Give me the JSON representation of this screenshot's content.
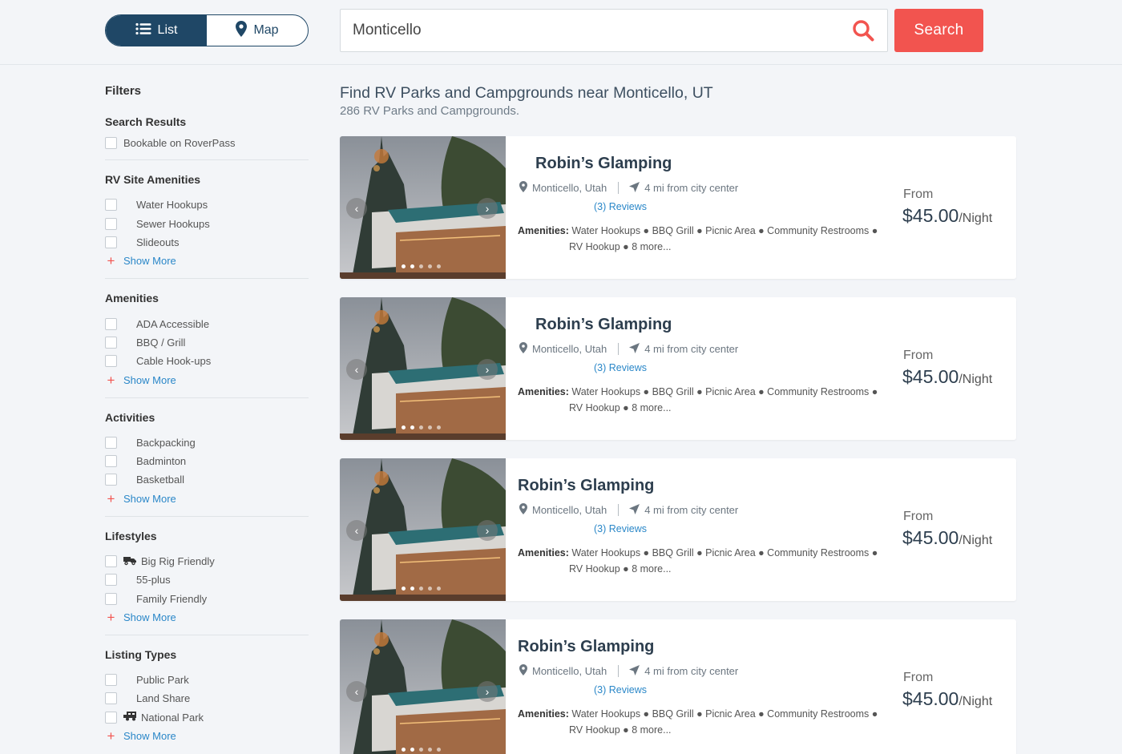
{
  "header": {
    "view_toggle": {
      "list_label": "List",
      "map_label": "Map"
    },
    "search": {
      "value": "Monticello",
      "button_label": "Search"
    }
  },
  "sidebar": {
    "title": "Filters",
    "sections": {
      "search_results": {
        "title": "Search Results",
        "items": [
          "Bookable on RoverPass"
        ]
      },
      "rv_site_amenities": {
        "title": "RV Site Amenities",
        "items": [
          "Water Hookups",
          "Sewer Hookups",
          "Slideouts"
        ],
        "show_more": "Show More"
      },
      "amenities": {
        "title": "Amenities",
        "items": [
          "ADA Accessible",
          "BBQ / Grill",
          "Cable Hook-ups"
        ],
        "show_more": "Show More"
      },
      "activities": {
        "title": "Activities",
        "items": [
          "Backpacking",
          "Badminton",
          "Basketball"
        ],
        "show_more": "Show More"
      },
      "lifestyles": {
        "title": "Lifestyles",
        "items": [
          "Big Rig Friendly",
          "55-plus",
          "Family Friendly"
        ],
        "show_more": "Show More"
      },
      "listing_types": {
        "title": "Listing Types",
        "items": [
          "Public Park",
          "Land Share",
          "National Park"
        ],
        "show_more": "Show More"
      }
    }
  },
  "main": {
    "title": "Find RV Parks and Campgrounds near Monticello, UT",
    "subtitle": "286 RV Parks and Campgrounds.",
    "listings": [
      {
        "name": "Robin’s Glamping",
        "location": "Monticello, Utah",
        "distance": "4 mi from city center",
        "reviews": "(3) Reviews",
        "amenities_label": "Amenities:",
        "amenities_line1": "Water Hookups ● BBQ Grill ● Picnic Area ● Community Restrooms ●",
        "amenities_line2": "RV Hookup ● 8 more...",
        "price_from": "From",
        "price": "$45.00",
        "price_unit": "/Night"
      },
      {
        "name": "Robin’s Glamping",
        "location": "Monticello, Utah",
        "distance": "4 mi from city center",
        "reviews": "(3) Reviews",
        "amenities_label": "Amenities:",
        "amenities_line1": "Water Hookups ● BBQ Grill ● Picnic Area ● Community Restrooms ●",
        "amenities_line2": "RV Hookup ● 8 more...",
        "price_from": "From",
        "price": "$45.00",
        "price_unit": "/Night"
      },
      {
        "name": "Robin’s Glamping",
        "location": "Monticello, Utah",
        "distance": "4 mi from city center",
        "reviews": "(3) Reviews",
        "amenities_label": "Amenities:",
        "amenities_line1": "Water Hookups ● BBQ Grill ● Picnic Area ● Community Restrooms ●",
        "amenities_line2": "RV Hookup ● 8 more...",
        "price_from": "From",
        "price": "$45.00",
        "price_unit": "/Night"
      },
      {
        "name": "Robin’s Glamping",
        "location": "Monticello, Utah",
        "distance": "4 mi from city center",
        "reviews": "(3) Reviews",
        "amenities_label": "Amenities:",
        "amenities_line1": "Water Hookups ● BBQ Grill ● Picnic Area ● Community Restrooms ●",
        "amenities_line2": "RV Hookup ● 8 more...",
        "price_from": "From",
        "price": "$45.00",
        "price_unit": "/Night"
      }
    ]
  },
  "colors": {
    "primary": "#1f4766",
    "accent": "#f2544f",
    "link": "#2a87c8"
  },
  "icons": {
    "list": "list-icon",
    "map": "map-pin-icon",
    "search": "search-icon",
    "location": "location-pin-icon",
    "distance": "navigation-arrow-icon",
    "big_rig": "truck-icon",
    "national_park": "rv-icon"
  }
}
